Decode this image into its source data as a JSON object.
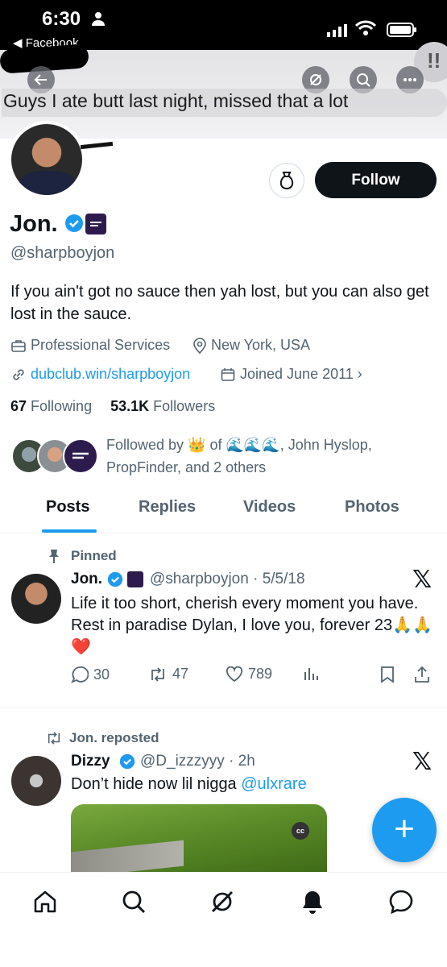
{
  "status_bar": {
    "time": "6:30",
    "back_app": "◀ Facebook"
  },
  "banner": {
    "text": "Guys I ate butt last night, missed that a lot"
  },
  "profile": {
    "follow_label": "Follow",
    "display_name": "Jon.",
    "handle": "@sharpboyjon",
    "bio": "If you ain't got no sauce then yah lost, but you can also get lost in the sauce.",
    "category": "Professional Services",
    "location": "New York, USA",
    "link": "dubclub.win/sharpboyjon",
    "joined": "Joined June 2011 ›",
    "following_count": "67",
    "following_label": "Following",
    "followers_count": "53.1K",
    "followers_label": "Followers",
    "followed_by": "Followed by 👑 of 🌊🌊🌊, John Hyslop, PropFinder, and 2 others"
  },
  "tabs": [
    {
      "label": "Posts"
    },
    {
      "label": "Replies"
    },
    {
      "label": "Videos"
    },
    {
      "label": "Photos"
    }
  ],
  "pinned_tweet": {
    "pinned_label": "Pinned",
    "name": "Jon.",
    "meta": "@sharpboyjon · 5/5/18",
    "text": "Life it too short, cherish every moment you have. Rest in paradise Dylan, I love you, forever 23🙏🙏❤️",
    "replies": "30",
    "retweets": "47",
    "likes": "789"
  },
  "repost_tweet": {
    "reposted_label": "Jon. reposted",
    "name": "Dizzy",
    "meta": "@D_izzzyyy · 2h",
    "text": "Don’t hide now lil nigga",
    "mention": "@ulxrare",
    "cc_label": "cc"
  },
  "fab": {
    "label": "+"
  },
  "icons": {
    "x_logo": "𝕏"
  },
  "colors": {
    "accent": "#1d9bf0",
    "follow_button": "#0f1419",
    "secondary_text": "#536471"
  }
}
